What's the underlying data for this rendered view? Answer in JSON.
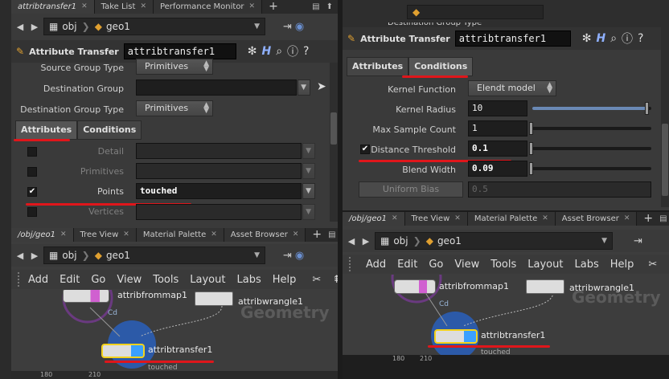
{
  "left": {
    "tabs": [
      "attribtransfer1",
      "Take List",
      "Performance Monitor"
    ],
    "path": [
      "obj",
      "geo1"
    ],
    "node_type": "Attribute Transfer",
    "node_name": "attribtransfer1",
    "params": {
      "source_group_type_label": "Source Group Type",
      "source_group_type_value": "Primitives",
      "dest_group_label": "Destination Group",
      "dest_group_type_label": "Destination Group Type",
      "dest_group_type_value": "Primitives"
    },
    "subtabs": [
      "Attributes",
      "Conditions"
    ],
    "attr_rows": [
      {
        "label": "Detail",
        "value": "",
        "checked": false
      },
      {
        "label": "Primitives",
        "value": "",
        "checked": false
      },
      {
        "label": "Points",
        "value": "touched",
        "checked": true
      },
      {
        "label": "Vertices",
        "value": "",
        "checked": false
      }
    ],
    "net_tabs": [
      "/obj/geo1",
      "Tree View",
      "Material Palette",
      "Asset Browser"
    ],
    "net_path": [
      "obj",
      "geo1"
    ],
    "menus": [
      "Add",
      "Edit",
      "Go",
      "View",
      "Tools",
      "Layout",
      "Labs",
      "Help"
    ],
    "nodes": {
      "attribfrommap": "attribfrommap1",
      "attribfrommap_sub": "Cd",
      "attribwrangle": "attribwrangle1",
      "attribtransfer": "attribtransfer1",
      "attribtransfer_sub": "touched"
    },
    "watermark": "Geometry",
    "ruler": [
      "180",
      "210"
    ]
  },
  "right": {
    "cut_label": "Destination Group Type",
    "node_type": "Attribute Transfer",
    "node_name": "attribtransfer1",
    "subtabs": [
      "Attributes",
      "Conditions"
    ],
    "kernel_function_label": "Kernel Function",
    "kernel_function_value": "Elendt model",
    "kernel_radius_label": "Kernel Radius",
    "kernel_radius_value": "10",
    "max_sample_label": "Max Sample Count",
    "max_sample_value": "1",
    "distance_threshold_label": "Distance Threshold",
    "distance_threshold_value": "0.1",
    "blend_width_label": "Blend Width",
    "blend_width_value": "0.09",
    "uniform_bias_label": "Uniform Bias",
    "uniform_bias_value": "0.5",
    "net_tabs": [
      "/obj/geo1",
      "Tree View",
      "Material Palette",
      "Asset Browser"
    ],
    "net_path": [
      "obj",
      "geo1"
    ],
    "menus": [
      "Add",
      "Edit",
      "Go",
      "View",
      "Tools",
      "Layout",
      "Labs",
      "Help"
    ],
    "nodes": {
      "attribfrommap": "attribfrommap1",
      "attribfrommap_sub": "Cd",
      "attribwrangle": "attribwrangle1",
      "attribtransfer": "attribtransfer1",
      "attribtransfer_sub": "touched"
    },
    "watermark": "Geometry",
    "ruler": [
      "180",
      "210"
    ]
  },
  "colors": {
    "accent_red": "#e0161b",
    "selected_node": "#f3d21b",
    "slider_fill": "#6a89b5"
  }
}
